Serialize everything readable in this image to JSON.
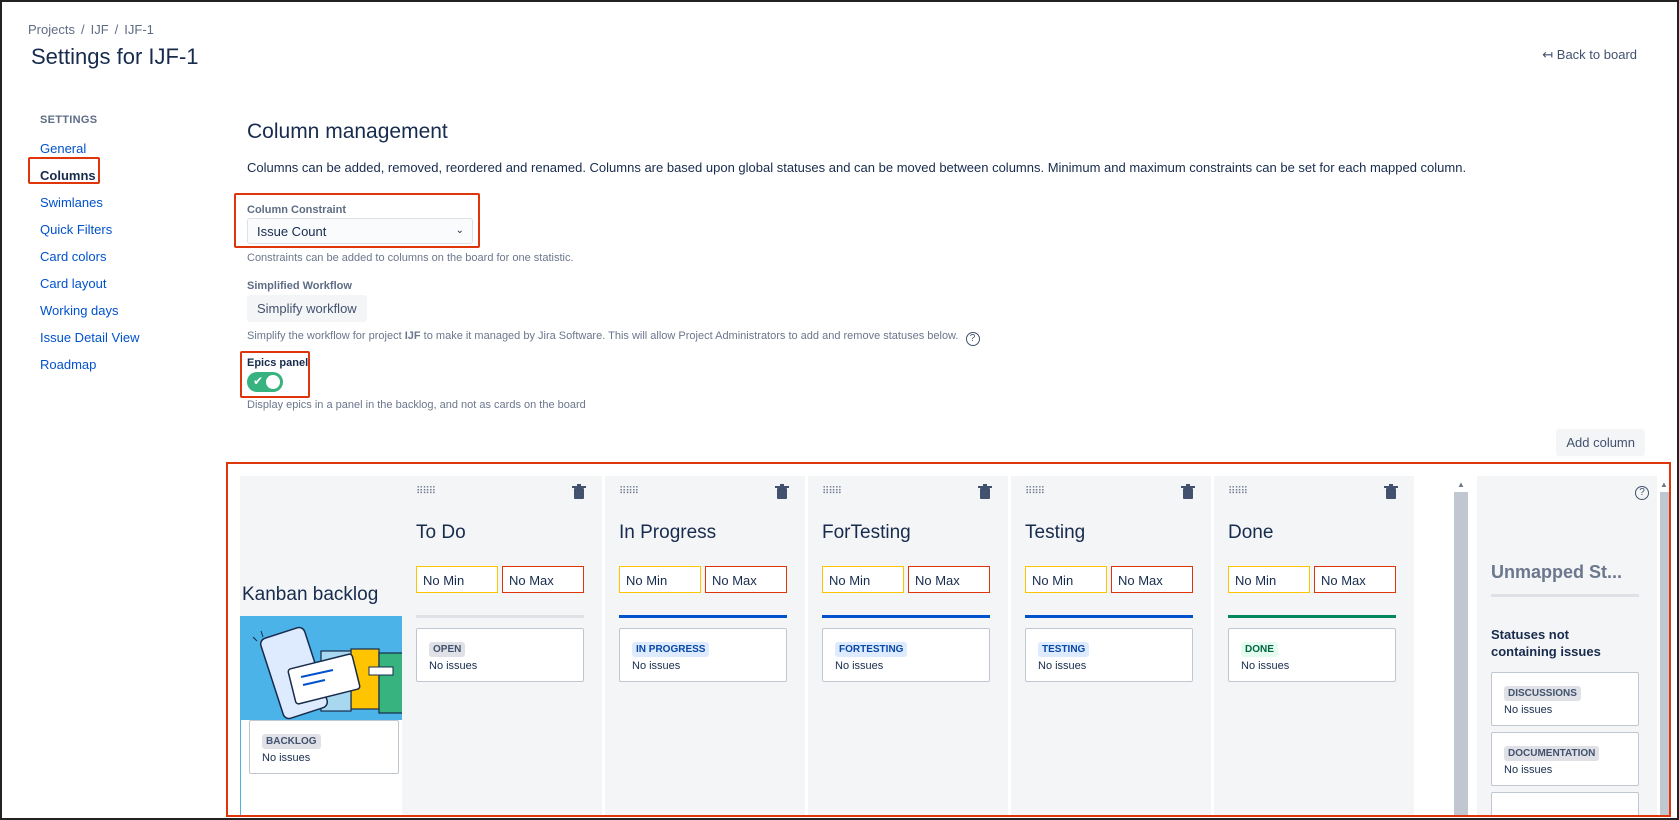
{
  "breadcrumb": [
    "Projects",
    "/",
    "IJF",
    "/",
    "IJF-1"
  ],
  "page_title": "Settings for IJF-1",
  "back_link": "Back to board",
  "sidebar": {
    "heading": "SETTINGS",
    "items": [
      "General",
      "Columns",
      "Swimlanes",
      "Quick Filters",
      "Card colors",
      "Card layout",
      "Working days",
      "Issue Detail View",
      "Roadmap"
    ],
    "active": "Columns"
  },
  "column_management": {
    "title": "Column management",
    "description": "Columns can be added, removed, reordered and renamed. Columns are based upon global statuses and can be moved between columns. Minimum and maximum constraints can be set for each mapped column.",
    "constraint_label": "Column Constraint",
    "constraint_value": "Issue Count",
    "constraint_help": "Constraints can be added to columns on the board for one statistic.",
    "workflow_label": "Simplified Workflow",
    "workflow_button": "Simplify workflow",
    "workflow_help_prefix": "Simplify the workflow for project ",
    "workflow_help_project": "IJF",
    "workflow_help_suffix": " to make it managed by Jira Software. This will allow Project Administrators to add and remove statuses below.",
    "epics_label": "Epics panel",
    "epics_enabled": true,
    "epics_help": "Display epics in a panel in the backlog, and not as cards on the board",
    "add_column": "Add column"
  },
  "board": {
    "backlog": {
      "title": "Kanban backlog",
      "status": "BACKLOG",
      "issues": "No issues"
    },
    "columns": [
      {
        "name": "To Do",
        "min": "No Min",
        "max": "No Max",
        "status": "OPEN",
        "issues": "No issues",
        "bar_color": "#dfe1e6",
        "lozenge_bg": "#dfe1e6",
        "lozenge_fg": "#42526e"
      },
      {
        "name": "In Progress",
        "min": "No Min",
        "max": "No Max",
        "status": "IN PROGRESS",
        "issues": "No issues",
        "bar_color": "#0052cc",
        "lozenge_bg": "#deebff",
        "lozenge_fg": "#0747a6"
      },
      {
        "name": "ForTesting",
        "min": "No Min",
        "max": "No Max",
        "status": "FORTESTING",
        "issues": "No issues",
        "bar_color": "#0052cc",
        "lozenge_bg": "#deebff",
        "lozenge_fg": "#0747a6"
      },
      {
        "name": "Testing",
        "min": "No Min",
        "max": "No Max",
        "status": "TESTING",
        "issues": "No issues",
        "bar_color": "#0052cc",
        "lozenge_bg": "#deebff",
        "lozenge_fg": "#0747a6"
      },
      {
        "name": "Done",
        "min": "No Min",
        "max": "No Max",
        "status": "DONE",
        "issues": "No issues",
        "bar_color": "#00875a",
        "lozenge_bg": "#e3fcef",
        "lozenge_fg": "#006644"
      }
    ],
    "unmapped": {
      "title": "Unmapped St...",
      "subtitle": "Statuses not containing issues",
      "statuses": [
        {
          "status": "DISCUSSIONS",
          "issues": "No issues"
        },
        {
          "status": "DOCUMENTATION",
          "issues": "No issues"
        }
      ]
    }
  }
}
